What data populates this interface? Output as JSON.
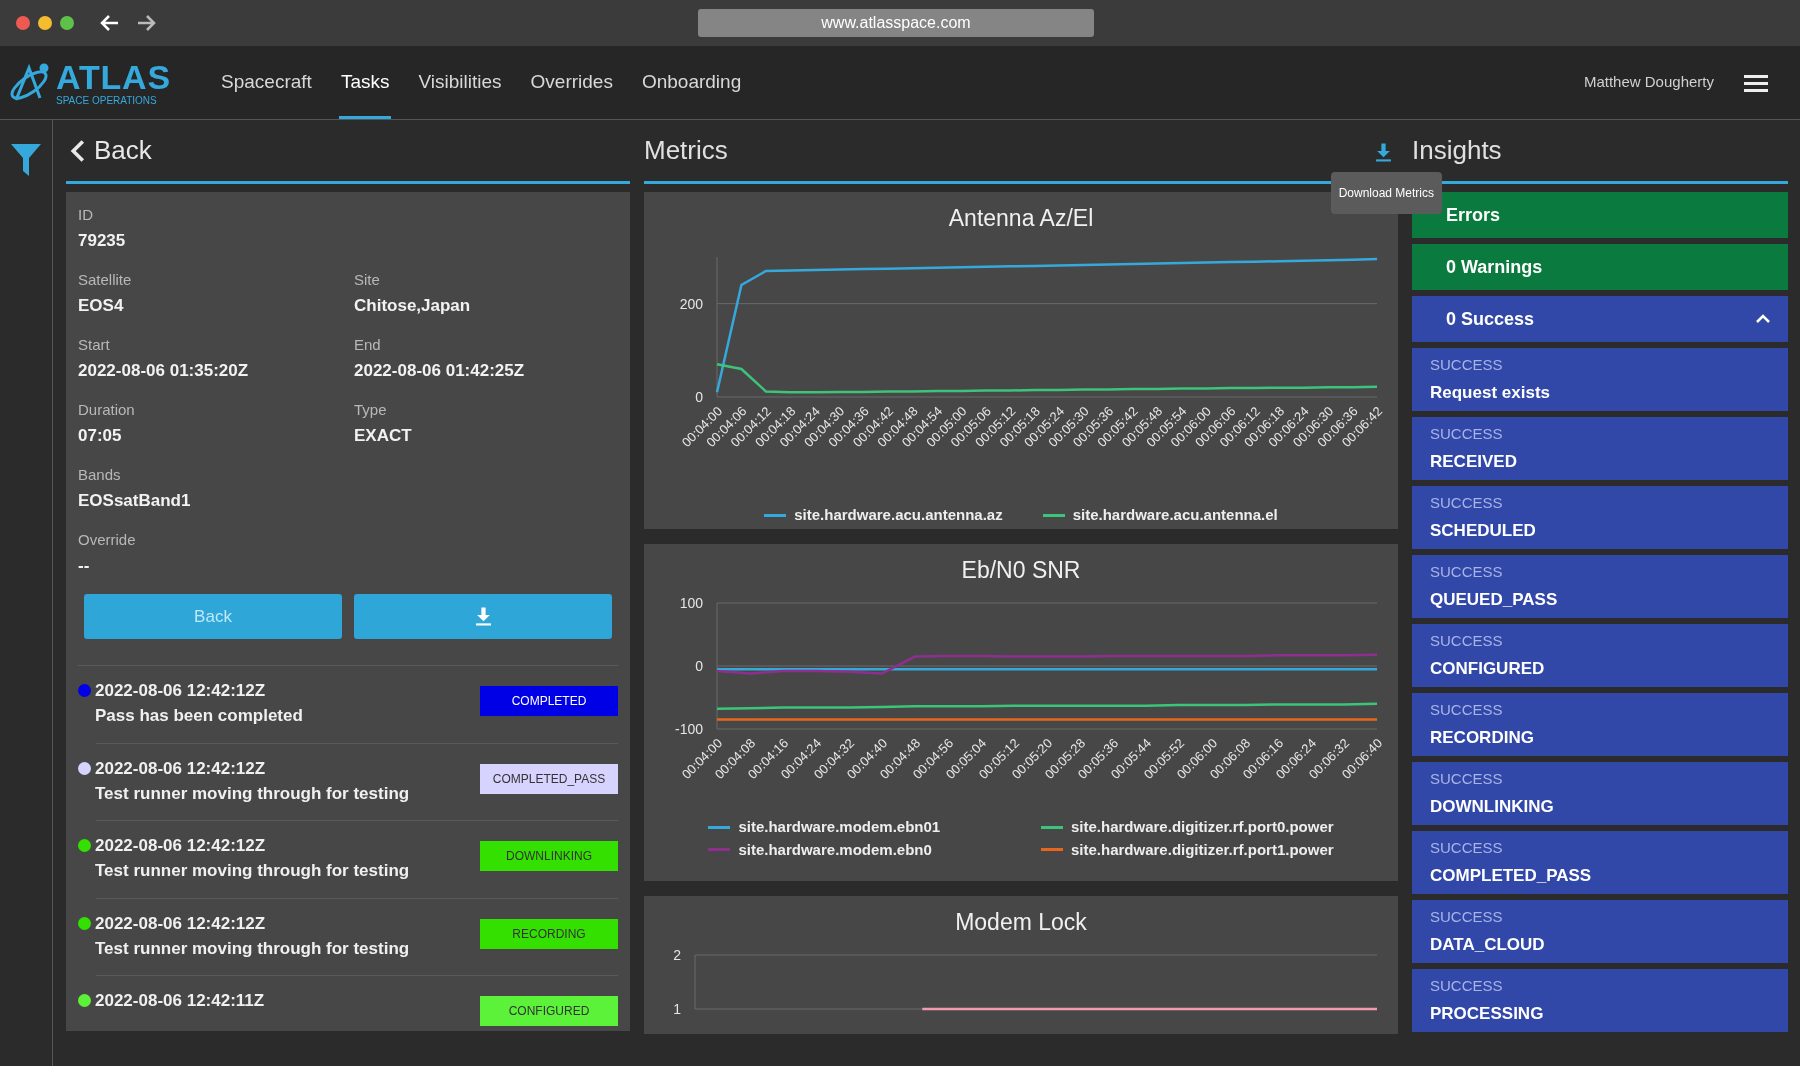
{
  "browser": {
    "url": "www.atlasspace.com"
  },
  "nav": {
    "logo_title": "ATLAS",
    "logo_subtitle": "SPACE OPERATIONS",
    "tabs": [
      {
        "label": "Spacecraft",
        "selected": false
      },
      {
        "label": "Tasks",
        "selected": true
      },
      {
        "label": "Visibilities",
        "selected": false
      },
      {
        "label": "Overrides",
        "selected": false
      },
      {
        "label": "Onboarding",
        "selected": false
      }
    ],
    "user": "Matthew Dougherty"
  },
  "details": {
    "back_label": "Back",
    "rows": [
      [
        {
          "label": "ID",
          "value": "79235"
        }
      ],
      [
        {
          "label": "Satellite",
          "value": "EOS4"
        },
        {
          "label": "Site",
          "value": "Chitose,Japan"
        }
      ],
      [
        {
          "label": "Start",
          "value": "2022-08-06 01:35:20Z"
        },
        {
          "label": "End",
          "value": "2022-08-06 01:42:25Z"
        }
      ],
      [
        {
          "label": "Duration",
          "value": "07:05"
        },
        {
          "label": "Type",
          "value": "EXACT"
        }
      ],
      [
        {
          "label": "Bands",
          "value": "EOSsatBand1"
        }
      ],
      [
        {
          "label": "Override",
          "value": "--"
        }
      ]
    ],
    "back_button": "Back"
  },
  "events": [
    {
      "time": "2022-08-06 12:42:12Z",
      "message": "Pass has been completed",
      "status": "COMPLETED",
      "color": "#0000e6",
      "dark_text": false
    },
    {
      "time": "2022-08-06 12:42:12Z",
      "message": "Test runner moving through for testing",
      "status": "COMPLETED_PASS",
      "color": "#d6d3ff",
      "dark_text": true
    },
    {
      "time": "2022-08-06 12:42:12Z",
      "message": "Test runner moving through for testing",
      "status": "DOWNLINKING",
      "color": "#33e000",
      "dark_text": true
    },
    {
      "time": "2022-08-06 12:42:12Z",
      "message": "Test runner moving through for testing",
      "status": "RECORDING",
      "color": "#33e000",
      "dark_text": true
    },
    {
      "time": "2022-08-06 12:42:11Z",
      "status": "CONFIGURED",
      "color": "#5cf23a",
      "dark_text": true
    }
  ],
  "metrics": {
    "title": "Metrics",
    "tooltip": "Download Metrics",
    "charts": [
      {
        "chart_data": {
          "type": "line",
          "title": "Antenna Az/El",
          "categories": [
            "00:04:00",
            "00:04:06",
            "00:04:12",
            "00:04:18",
            "00:04:24",
            "00:04:30",
            "00:04:36",
            "00:04:42",
            "00:04:48",
            "00:04:54",
            "00:05:00",
            "00:05:06",
            "00:05:12",
            "00:05:18",
            "00:05:24",
            "00:05:30",
            "00:05:36",
            "00:05:42",
            "00:05:48",
            "00:05:54",
            "00:06:00",
            "00:06:06",
            "00:06:12",
            "00:06:18",
            "00:06:24",
            "00:06:30",
            "00:06:36",
            "00:06:42"
          ],
          "ylim": [
            0,
            300
          ],
          "yticks": [
            0,
            200
          ],
          "series": [
            {
              "name": "site.hardware.acu.antenna.az",
              "color": "#35a9dc",
              "values": [
                10,
                240,
                270,
                271,
                272,
                273,
                274,
                275,
                276,
                277,
                278,
                279,
                280,
                281,
                282,
                283,
                284,
                285,
                286,
                287,
                288,
                289,
                290,
                291,
                292,
                293,
                294,
                296
              ]
            },
            {
              "name": "site.hardware.acu.antenna.el",
              "color": "#3cc47a",
              "values": [
                70,
                60,
                12,
                10,
                10,
                11,
                11,
                12,
                12,
                13,
                13,
                14,
                14,
                15,
                15,
                16,
                16,
                17,
                17,
                18,
                18,
                19,
                19,
                20,
                20,
                21,
                21,
                22
              ]
            }
          ]
        }
      },
      {
        "chart_data": {
          "type": "line",
          "title": "Eb/N0 SNR",
          "categories": [
            "00:04:00",
            "00:04:08",
            "00:04:16",
            "00:04:24",
            "00:04:32",
            "00:04:40",
            "00:04:48",
            "00:04:56",
            "00:05:04",
            "00:05:12",
            "00:05:20",
            "00:05:28",
            "00:05:36",
            "00:05:44",
            "00:05:52",
            "00:06:00",
            "00:06:08",
            "00:06:16",
            "00:06:24",
            "00:06:32",
            "00:06:40"
          ],
          "ylim": [
            -100,
            100
          ],
          "yticks": [
            -100,
            0,
            100
          ],
          "series": [
            {
              "name": "site.hardware.modem.ebn01",
              "color": "#35a9dc",
              "values": [
                -5,
                -5,
                -5,
                -5,
                -5,
                -5,
                -5,
                -5,
                -5,
                -5,
                -5,
                -5,
                -5,
                -5,
                -5,
                -5,
                -5,
                -5,
                -5,
                -5,
                -5
              ]
            },
            {
              "name": "site.hardware.digitizer.rf.port0.power",
              "color": "#3cc47a",
              "values": [
                -68,
                -67,
                -66,
                -66,
                -66,
                -65,
                -64,
                -64,
                -64,
                -63,
                -63,
                -63,
                -63,
                -63,
                -62,
                -62,
                -62,
                -61,
                -61,
                -61,
                -60
              ]
            },
            {
              "name": "site.hardware.modem.ebn0",
              "color": "#8e2f8e",
              "values": [
                -8,
                -12,
                -8,
                -8,
                -9,
                -12,
                15,
                16,
                16,
                15,
                15,
                15,
                16,
                16,
                16,
                16,
                16,
                17,
                17,
                17,
                18
              ]
            },
            {
              "name": "site.hardware.digitizer.rf.port1.power",
              "color": "#e8661c",
              "values": [
                -85,
                -85,
                -85,
                -85,
                -85,
                -85,
                -85,
                -85,
                -85,
                -85,
                -85,
                -85,
                -85,
                -85,
                -85,
                -85,
                -85,
                -85,
                -85,
                -85,
                -85
              ]
            }
          ]
        }
      },
      {
        "chart_data": {
          "type": "line",
          "title": "Modem Lock",
          "ylim": [
            1,
            2
          ],
          "yticks": [
            1,
            2
          ],
          "series": [
            {
              "color": "#f49ab0",
              "values": [
                null,
                null,
                null,
                null,
                null,
                null,
                null,
                1,
                1,
                1,
                1,
                1,
                1,
                1,
                1,
                1,
                1,
                1,
                1,
                1,
                1,
                1
              ]
            }
          ]
        }
      }
    ]
  },
  "insights": {
    "title": "Insights",
    "summary": [
      {
        "label": "Errors",
        "kind": "ok"
      },
      {
        "label": "0 Warnings",
        "kind": "ok"
      },
      {
        "label": "0 Success",
        "kind": "info",
        "expanded": true
      }
    ],
    "items": [
      {
        "kind": "SUCCESS",
        "title": "Request exists"
      },
      {
        "kind": "SUCCESS",
        "title": "RECEIVED"
      },
      {
        "kind": "SUCCESS",
        "title": "SCHEDULED"
      },
      {
        "kind": "SUCCESS",
        "title": "QUEUED_PASS"
      },
      {
        "kind": "SUCCESS",
        "title": "CONFIGURED"
      },
      {
        "kind": "SUCCESS",
        "title": "RECORDING"
      },
      {
        "kind": "SUCCESS",
        "title": "DOWNLINKING"
      },
      {
        "kind": "SUCCESS",
        "title": "COMPLETED_PASS"
      },
      {
        "kind": "SUCCESS",
        "title": "DATA_CLOUD"
      },
      {
        "kind": "SUCCESS",
        "title": "PROCESSING"
      }
    ]
  }
}
